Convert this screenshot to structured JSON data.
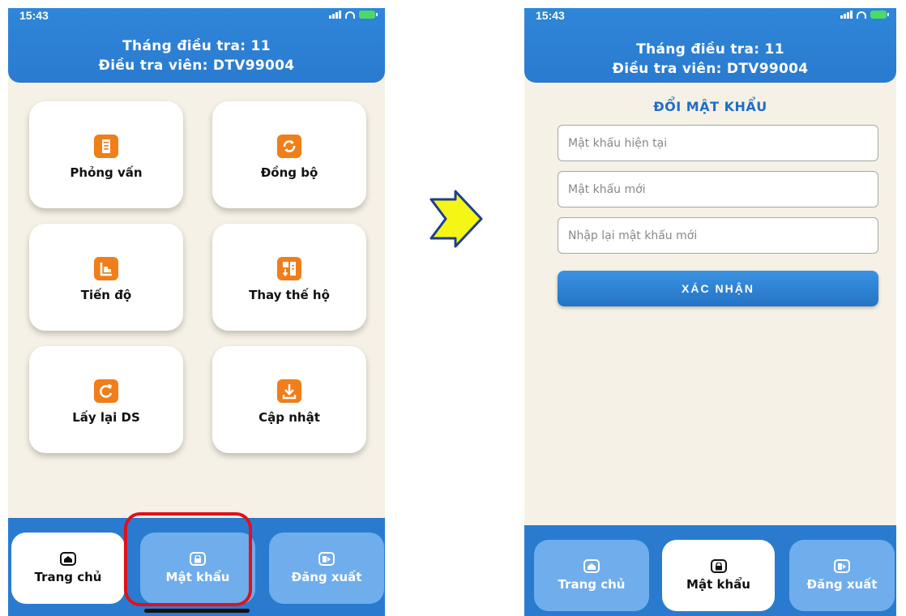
{
  "left_screen": {
    "status_time": "15:43",
    "header": {
      "line1": "Tháng điều tra: 11",
      "line2": "Điều tra viên: DTV99004"
    },
    "tiles": [
      {
        "label": "Phỏng vấn",
        "icon": "document-icon"
      },
      {
        "label": "Đồng bộ",
        "icon": "sync-icon"
      },
      {
        "label": "Tiến độ",
        "icon": "progress-icon"
      },
      {
        "label": "Thay thế hộ",
        "icon": "replace-household-icon"
      },
      {
        "label": "Lấy lại DS",
        "icon": "reload-icon"
      },
      {
        "label": "Cập nhật",
        "icon": "download-icon"
      }
    ],
    "nav": [
      {
        "label": "Trang chủ",
        "icon": "home-icon",
        "active": true
      },
      {
        "label": "Mật khẩu",
        "icon": "lock-icon",
        "active": false
      },
      {
        "label": "Đăng xuất",
        "icon": "logout-icon",
        "active": false
      }
    ]
  },
  "right_screen": {
    "status_time": "15:43",
    "header": {
      "line1": "Tháng điều tra: 11",
      "line2": "Điều tra viên: DTV99004"
    },
    "title": "ĐỔI MẬT KHẨU",
    "inputs": [
      {
        "placeholder": "Mật khẩu hiện tại",
        "value": ""
      },
      {
        "placeholder": "Mật khẩu mới",
        "value": ""
      },
      {
        "placeholder": "Nhập lại mật khẩu mới",
        "value": ""
      }
    ],
    "confirm_label": "XÁC NHẬN",
    "nav": [
      {
        "label": "Trang chủ",
        "icon": "home-icon",
        "active": false
      },
      {
        "label": "Mật khẩu",
        "icon": "lock-icon",
        "active": true
      },
      {
        "label": "Đăng xuất",
        "icon": "logout-icon",
        "active": false
      }
    ]
  },
  "colors": {
    "header_blue": "#2a7bcf",
    "tile_icon_orange": "#f07e1a",
    "nav_inactive": "#6fadec",
    "highlight_red": "#e0111c",
    "arrow_yellow": "#f5f516",
    "page_bg": "#f6f1e6"
  }
}
